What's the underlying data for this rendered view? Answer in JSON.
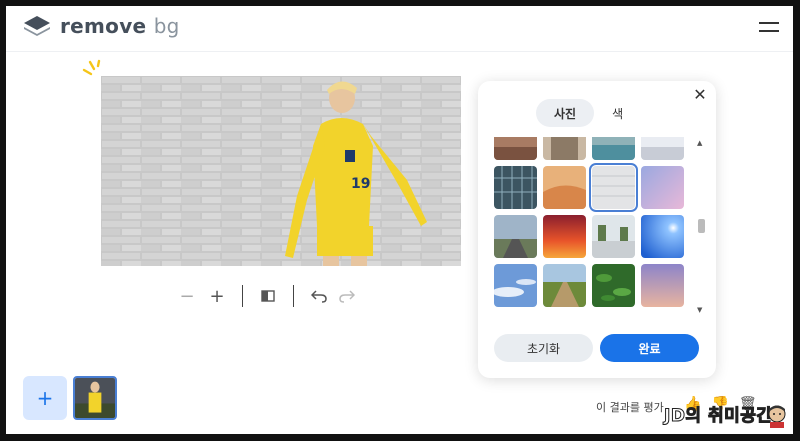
{
  "header": {
    "brand_main": "remove",
    "brand_suffix": "bg",
    "icons": {
      "logo": "layers-logo-icon",
      "menu": "hamburger-menu-icon"
    }
  },
  "preview": {
    "icons": {
      "sparkle": "sparkle-icon"
    }
  },
  "toolbar": {
    "zoom_out": "−",
    "zoom_in": "+",
    "icons": {
      "compare": "compare-icon",
      "undo": "undo-icon",
      "redo": "redo-icon"
    }
  },
  "background_panel": {
    "tabs": [
      {
        "label": "사진",
        "active": true
      },
      {
        "label": "색",
        "active": false
      }
    ],
    "close_icon": "close-icon",
    "reset_label": "초기화",
    "done_label": "완료",
    "selected_index": 6,
    "backgrounds": [
      "wood-wall",
      "room-interior",
      "pool-resort",
      "snowy-street",
      "glass-building",
      "desert-dunes",
      "white-brick",
      "pink-sky",
      "country-road",
      "sunset-gradient",
      "white-courtyard",
      "blue-sun-sky",
      "blue-clouds",
      "dirt-road-field",
      "green-leaves",
      "purple-dusk"
    ]
  },
  "bottom": {
    "add_label": "+",
    "rate_label": "이 결과를 평가",
    "watermark": "JD의 취미공간",
    "icons": {
      "thumbs_up": "thumbs-up-icon",
      "thumbs_down": "thumbs-down-icon",
      "trash": "trash-icon"
    }
  },
  "colors": {
    "accent": "#1a73e8",
    "add_bg": "#d8e7ff",
    "reset_bg": "#e9edf1"
  }
}
